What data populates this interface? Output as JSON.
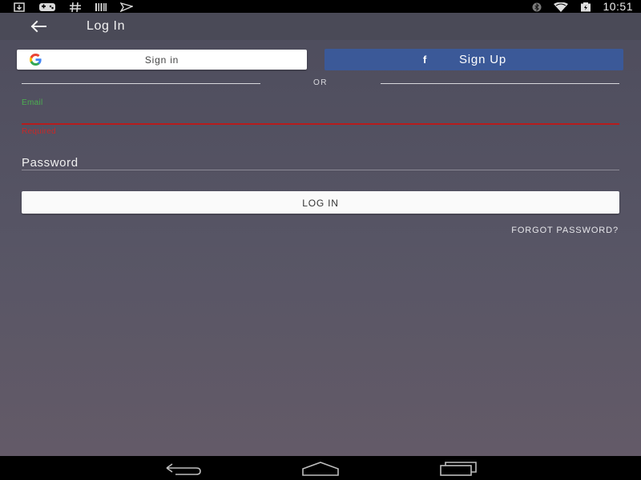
{
  "status_bar": {
    "time": "10:51",
    "left_icons": [
      "download-icon",
      "gamepad-icon",
      "hashtag-icon",
      "barcode-icon",
      "send-icon"
    ],
    "right_icons": [
      "bluetooth-icon",
      "wifi-icon",
      "battery-icon"
    ]
  },
  "toolbar": {
    "title": "Log In",
    "back_icon": "arrow-back-icon"
  },
  "social": {
    "google_label": "Sign in",
    "facebook_icon": "f",
    "facebook_label": "Sign Up"
  },
  "divider": {
    "or_text": "OR"
  },
  "form": {
    "email_label": "Email",
    "email_value": "",
    "email_error": "Required",
    "password_placeholder": "Password",
    "password_value": "",
    "login_label": "LOG IN",
    "forgot_label": "FORGOT PASSWORD?"
  },
  "nav_bar": {
    "buttons": [
      "back-nav-icon",
      "home-nav-icon",
      "recents-nav-icon"
    ]
  },
  "colors": {
    "facebook_blue": "#3b5998",
    "email_label_green": "#4caf50",
    "error_red": "#c62828",
    "background": "#575565"
  }
}
